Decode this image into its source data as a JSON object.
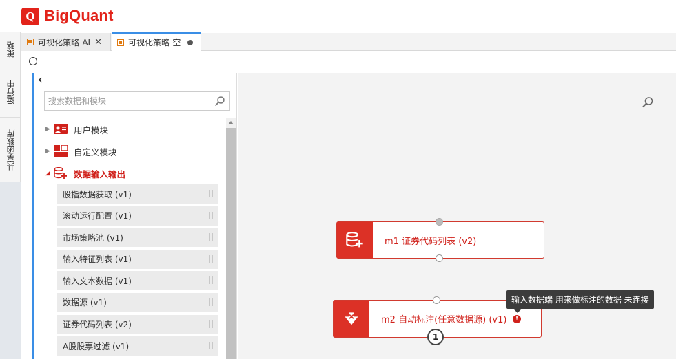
{
  "app": {
    "logo_mark": "Q",
    "logo_text": "BigQuant"
  },
  "vtabs": [
    {
      "label": "策略"
    },
    {
      "label": "运行中"
    },
    {
      "label": "共享函数库"
    }
  ],
  "doctabs": [
    {
      "label": "可视化策略-AI"
    },
    {
      "label": "可视化策略-空"
    }
  ],
  "sidebar": {
    "collapse_glyph": "‹",
    "search_placeholder": "搜索数据和模块",
    "groups": [
      {
        "label": "用户模块",
        "expanded": false,
        "icon": "user-card-icon"
      },
      {
        "label": "自定义模块",
        "expanded": false,
        "icon": "custom-module-icon"
      },
      {
        "label": "数据输入输出",
        "expanded": true,
        "icon": "database-plus-icon"
      }
    ],
    "items": [
      "股指数据获取 (v1)",
      "滚动运行配置 (v1)",
      "市场策略池 (v1)",
      "输入特征列表 (v1)",
      "输入文本数据 (v1)",
      "数据源 (v1)",
      "证券代码列表 (v2)",
      "A股股票过滤 (v1)"
    ]
  },
  "canvas": {
    "modules": [
      {
        "label": "m1 证券代码列表 (v2)",
        "icon": "database-plus-icon"
      },
      {
        "label": "m2 自动标注(任意数据源) (v1)",
        "icon": "auto-label-icon",
        "warning": "!"
      }
    ],
    "badge": "1",
    "tooltip": "输入数据端 用来做标注的数据 未连接"
  },
  "colors": {
    "brand": "#e2231a",
    "accent": "#3a8ee6",
    "module_red": "#dc3126"
  }
}
